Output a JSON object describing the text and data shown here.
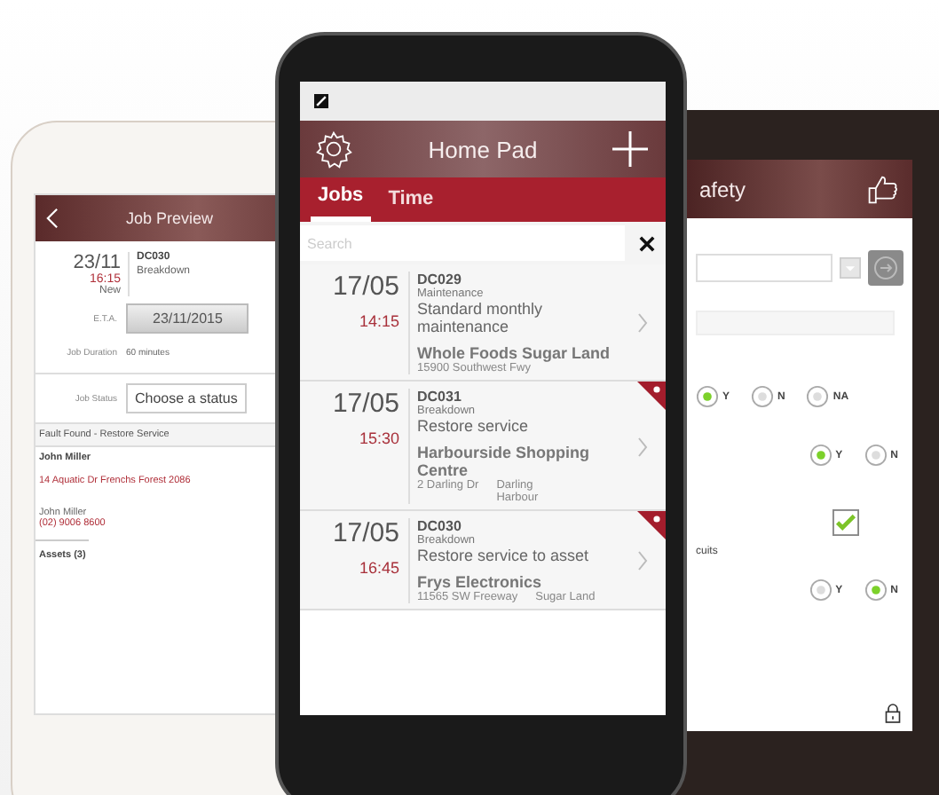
{
  "job_preview": {
    "title": "Job Preview",
    "date": "23/11",
    "time": "16:15",
    "status": "New",
    "code": "DC030",
    "type": "Breakdown",
    "eta_label": "E.T.A.",
    "eta_value": "23/11/2015",
    "duration_label": "Job Duration",
    "duration_value": "60 minutes",
    "status_label": "Job Status",
    "status_placeholder": "Choose a status",
    "fault": "Fault Found - Restore Service",
    "contact_name": "John Miller",
    "address": "14 Aquatic Dr  Frenchs Forest 2086",
    "contact_name_2": "John Miller",
    "phone": "(02) 9006 8600",
    "assets": "Assets (3)"
  },
  "home_pad": {
    "title": "Home Pad",
    "tabs": [
      {
        "label": "Jobs",
        "selected": true
      },
      {
        "label": "Time",
        "selected": false
      }
    ],
    "search": {
      "placeholder": "Search"
    },
    "jobs": [
      {
        "date": "17/05",
        "time": "14:15",
        "code": "DC029",
        "type": "Maintenance",
        "description": "Standard monthly maintenance",
        "site": "Whole Foods Sugar Land",
        "address": "15900 Southwest Fwy",
        "starred": false
      },
      {
        "date": "17/05",
        "time": "15:30",
        "code": "DC031",
        "type": "Breakdown",
        "description": "Restore service",
        "site": "Harbourside Shopping Centre",
        "address": "2 Darling Dr",
        "city": "Darling Harbour",
        "starred": true
      },
      {
        "date": "17/05",
        "time": "16:45",
        "code": "DC030",
        "type": "Breakdown",
        "description": "Restore service to asset",
        "site": "Frys Electronics",
        "address": "11565 SW Freeway",
        "city": "Sugar Land",
        "starred": true
      }
    ]
  },
  "safety": {
    "title": "afety",
    "label": "cuits",
    "radio_groups": [
      {
        "options": [
          {
            "label": "Y",
            "selected": true
          },
          {
            "label": "N",
            "selected": false
          },
          {
            "label": "NA",
            "selected": false
          }
        ]
      },
      {
        "options": [
          {
            "label": "Y",
            "selected": true
          },
          {
            "label": "N",
            "selected": false
          }
        ]
      },
      {
        "options": [
          {
            "label": "Y",
            "selected": false
          },
          {
            "label": "N",
            "selected": true
          }
        ]
      }
    ],
    "checkbox": {
      "checked": true
    }
  }
}
